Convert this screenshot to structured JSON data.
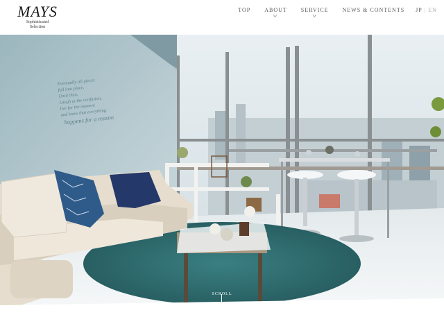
{
  "brand": {
    "logo": "MAYS",
    "tagline_line1": "Sophisticated",
    "tagline_line2": "Selection"
  },
  "nav": {
    "top": "TOP",
    "about": "ABOUT",
    "service": "SERVICE",
    "news": "NEWS & CONTENTS",
    "lang_jp": "JP",
    "lang_sep": "|",
    "lang_en": "EN"
  },
  "hero": {
    "wall_text_line1": "Eventually all pieces",
    "wall_text_line2": "fall into place.",
    "wall_text_line3": "Until then,",
    "wall_text_line4": "Laugh at the confusion,",
    "wall_text_line5": "live for the moment",
    "wall_text_line6": "and know that everything",
    "wall_text_line7": "happens for a reason",
    "scroll_label": "SCROLL"
  },
  "colors": {
    "accent": "#2b5f73",
    "rug": "#2e6d70",
    "sofa": "#e6ddce",
    "wall": "#a7bfc6"
  }
}
